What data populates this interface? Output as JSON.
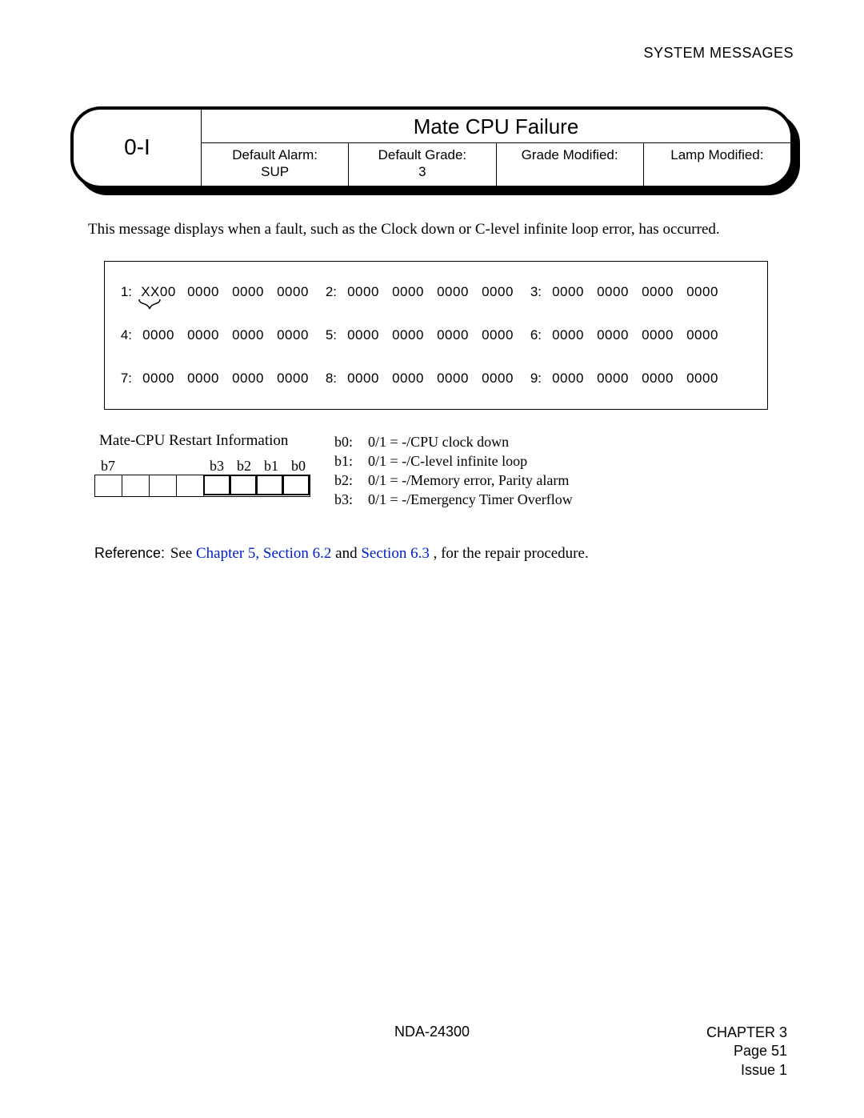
{
  "header": {
    "running_head": "SYSTEM MESSAGES"
  },
  "card": {
    "code": "0-I",
    "title": "Mate CPU Failure",
    "cells": {
      "default_alarm_label": "Default Alarm:",
      "default_alarm_value": "SUP",
      "default_grade_label": "Default Grade:",
      "default_grade_value": "3",
      "grade_modified_label": "Grade Modified:",
      "grade_modified_value": "",
      "lamp_modified_label": "Lamp Modified:",
      "lamp_modified_value": ""
    }
  },
  "description": "This message displays when a fault, such as the Clock down or C-level infinite loop error, has occurred.",
  "dump": {
    "rows": [
      {
        "groups": [
          {
            "label": "1:",
            "words": [
              "XX00",
              "0000",
              "0000",
              "0000"
            ]
          },
          {
            "label": "2:",
            "words": [
              "0000",
              "0000",
              "0000",
              "0000"
            ]
          },
          {
            "label": "3:",
            "words": [
              "0000",
              "0000",
              "0000",
              "0000"
            ]
          }
        ]
      },
      {
        "groups": [
          {
            "label": "4:",
            "words": [
              "0000",
              "0000",
              "0000",
              "0000"
            ]
          },
          {
            "label": "5:",
            "words": [
              "0000",
              "0000",
              "0000",
              "0000"
            ]
          },
          {
            "label": "6:",
            "words": [
              "0000",
              "0000",
              "0000",
              "0000"
            ]
          }
        ]
      },
      {
        "groups": [
          {
            "label": "7:",
            "words": [
              "0000",
              "0000",
              "0000",
              "0000"
            ]
          },
          {
            "label": "8:",
            "words": [
              "0000",
              "0000",
              "0000",
              "0000"
            ]
          },
          {
            "label": "9:",
            "words": [
              "0000",
              "0000",
              "0000",
              "0000"
            ]
          }
        ]
      }
    ]
  },
  "bits": {
    "title": "Mate-CPU Restart Information",
    "labels": [
      "b7",
      "",
      "",
      "",
      "b3",
      "b2",
      "b1",
      "b0"
    ],
    "bold_from_index": 4,
    "legend": [
      {
        "key": "b0:",
        "text": "0/1 = -/CPU clock down"
      },
      {
        "key": "b1:",
        "text": "0/1 = -/C-level infinite loop"
      },
      {
        "key": "b2:",
        "text": "0/1 = -/Memory error, Parity alarm"
      },
      {
        "key": "b3:",
        "text": "0/1 = -/Emergency Timer Overflow"
      }
    ]
  },
  "reference": {
    "label": "Reference:",
    "prefix": "See ",
    "link1": "Chapter 5, Section 6.2",
    "middle": " and ",
    "link2": "Section 6.3",
    "suffix": ", for the repair procedure."
  },
  "footer": {
    "doc_no": "NDA-24300",
    "chapter": "CHAPTER 3",
    "page": "Page 51",
    "issue": "Issue 1"
  }
}
